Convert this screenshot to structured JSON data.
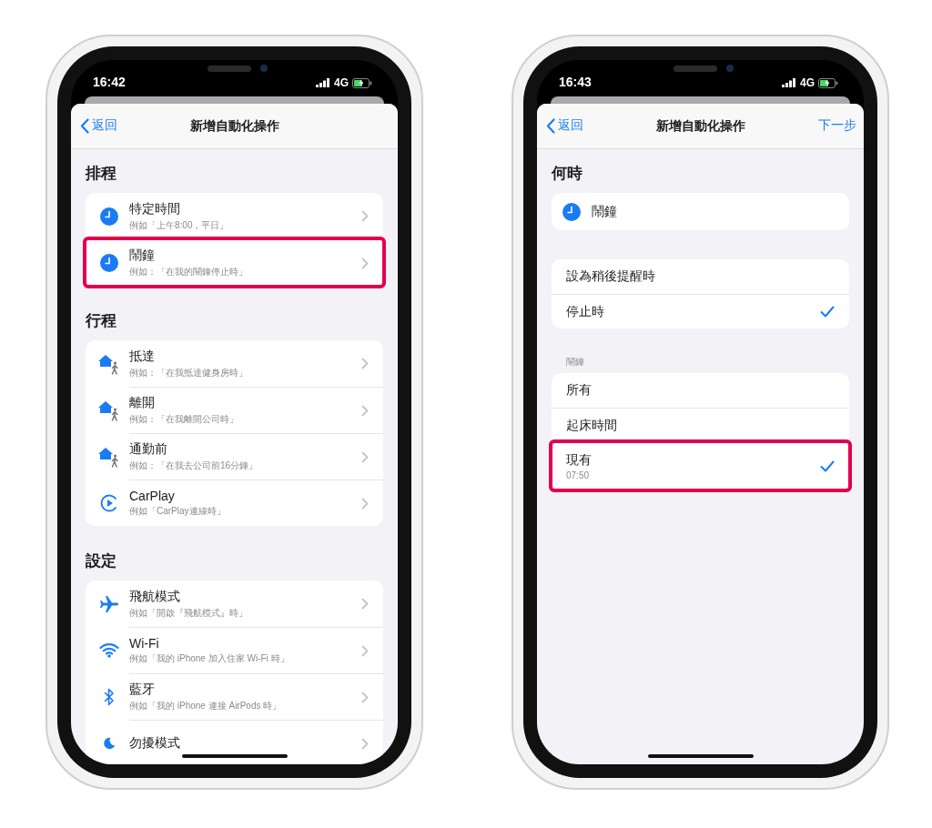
{
  "phones": [
    {
      "status": {
        "time": "16:42",
        "network": "4G"
      },
      "nav": {
        "back": "返回",
        "title": "新增自動化操作"
      },
      "sections": [
        {
          "header": "排程",
          "kind": "nav",
          "rows": [
            {
              "kind": "clock",
              "title": "特定時間",
              "subtitle": "例如「上午8:00，平日」",
              "highlighted": false
            },
            {
              "kind": "clock",
              "title": "鬧鐘",
              "subtitle": "例如：「在我的鬧鐘停止時」",
              "highlighted": true
            }
          ]
        },
        {
          "header": "行程",
          "kind": "nav",
          "rows": [
            {
              "kind": "location",
              "title": "抵達",
              "subtitle": "例如：「在我抵達健身房時」",
              "highlighted": false
            },
            {
              "kind": "location",
              "title": "離開",
              "subtitle": "例如：「在我離開公司時」",
              "highlighted": false
            },
            {
              "kind": "location",
              "title": "通勤前",
              "subtitle": "例如：「在我去公司前16分鐘」",
              "highlighted": false
            },
            {
              "kind": "carplay",
              "title": "CarPlay",
              "subtitle": "例如「CarPlay連線時」",
              "highlighted": false
            }
          ]
        },
        {
          "header": "設定",
          "kind": "nav",
          "rows": [
            {
              "kind": "airplane",
              "title": "飛航模式",
              "subtitle": "例如「開啟『飛航模式』時」",
              "highlighted": false
            },
            {
              "kind": "wifi",
              "title": "Wi-Fi",
              "subtitle": "例如「我的 iPhone 加入住家 Wi-Fi 時」",
              "highlighted": false
            },
            {
              "kind": "bluetooth",
              "title": "藍牙",
              "subtitle": "例如「我的 iPhone 連接 AirPods 時」",
              "highlighted": false
            },
            {
              "kind": "focus",
              "title": "勿擾模式",
              "highlighted": false
            }
          ]
        }
      ]
    },
    {
      "status": {
        "time": "16:43",
        "network": "4G"
      },
      "nav": {
        "back": "返回",
        "title": "新增自動化操作",
        "next": "下一步"
      },
      "sections": [
        {
          "header": "何時",
          "kind": "plain",
          "rows": [
            {
              "kind": "clock",
              "title": "鬧鐘",
              "highlighted": false
            }
          ]
        },
        {
          "kind": "choice",
          "rows": [
            {
              "title": "設為稍後提醒時",
              "checked": false,
              "highlighted": false
            },
            {
              "title": "停止時",
              "checked": true,
              "highlighted": false
            }
          ]
        },
        {
          "caption": "鬧鐘",
          "kind": "choice",
          "rows": [
            {
              "title": "所有",
              "checked": false,
              "highlighted": false
            },
            {
              "title": "起床時間",
              "checked": false,
              "highlighted": false
            },
            {
              "title": "現有",
              "subtitle": "07:50",
              "checked": true,
              "highlighted": true
            }
          ]
        }
      ]
    }
  ]
}
